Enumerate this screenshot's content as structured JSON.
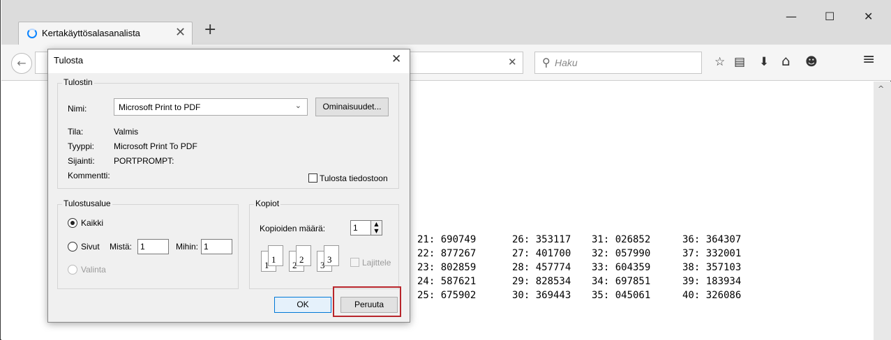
{
  "browser": {
    "tab_title": "Kertakäyttösalasanalista",
    "tab_close": "✕",
    "new_tab": "+",
    "window_min": "—",
    "window_max": "☐",
    "window_close": "✕",
    "back": "←",
    "url_clear": "✕",
    "search_placeholder": "Haku",
    "search_icon": "⚲",
    "icons": {
      "bookmark": "☆",
      "reader": "▤",
      "download": "⬇",
      "home": "⌂",
      "smile": "☻",
      "menu": "≡"
    },
    "scroll_up": "^"
  },
  "page": {
    "columns": [
      [
        "21: 690749",
        "22: 877267",
        "23: 802859",
        "24: 587621",
        "25: 675902"
      ],
      [
        "26: 353117",
        "27: 401700",
        "28: 457774",
        "29: 828534",
        "30: 369443"
      ],
      [
        "31: 026852",
        "32: 057990",
        "33: 604359",
        "34: 697851",
        "35: 045061"
      ],
      [
        "36: 364307",
        "37: 332001",
        "38: 357103",
        "39: 183934",
        "40: 326086"
      ]
    ]
  },
  "dialog": {
    "title": "Tulosta",
    "close": "✕",
    "printer_group": {
      "label": "Tulostin",
      "name_label": "Nimi:",
      "name_value": "Microsoft Print to PDF",
      "properties_button": "Ominaisuudet...",
      "status_label": "Tila:",
      "status_value": "Valmis",
      "type_label": "Tyyppi:",
      "type_value": "Microsoft Print To PDF",
      "location_label": "Sijainti:",
      "location_value": "PORTPROMPT:",
      "comment_label": "Kommentti:",
      "print_to_file": "Tulosta tiedostoon"
    },
    "range_group": {
      "label": "Tulostusalue",
      "all": "Kaikki",
      "pages": "Sivut",
      "from_label": "Mistä:",
      "from_value": "1",
      "to_label": "Mihin:",
      "to_value": "1",
      "selection": "Valinta"
    },
    "copies_group": {
      "label": "Kopiot",
      "count_label": "Kopioiden määrä:",
      "count_value": "1",
      "collate": "Lajittele",
      "page_icons": [
        "1",
        "1",
        "2",
        "2",
        "3",
        "3"
      ]
    },
    "ok_button": "OK",
    "cancel_button": "Peruuta"
  }
}
